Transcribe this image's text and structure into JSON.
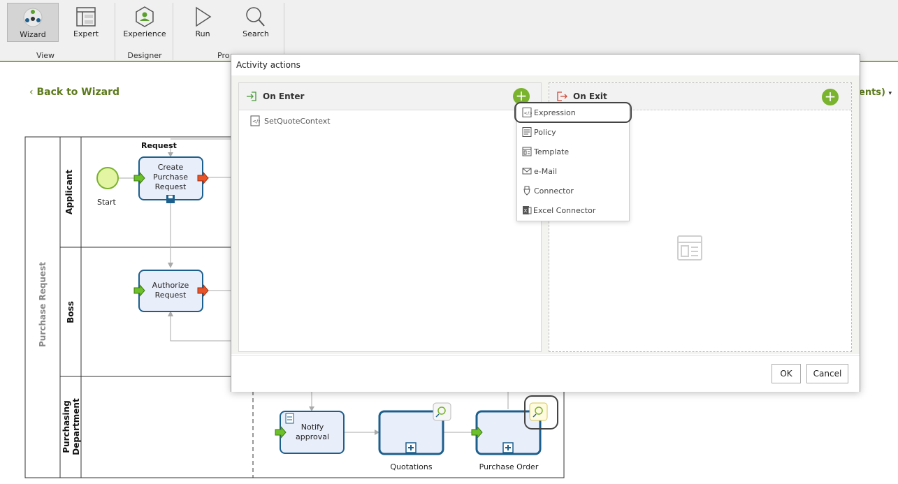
{
  "ribbon": {
    "buttons": [
      {
        "label": "Wizard",
        "icon": "wizard-icon"
      },
      {
        "label": "Expert",
        "icon": "expert-icon"
      },
      {
        "label": "Experience",
        "icon": "experience-icon"
      },
      {
        "label": "Run",
        "icon": "run-icon"
      },
      {
        "label": "Search",
        "icon": "search-icon"
      }
    ],
    "groups": {
      "view": "View",
      "designer": "Designer",
      "process": "Pro"
    }
  },
  "back_link": "Back to Wizard",
  "background_fragment": "ents)",
  "diagram": {
    "pool": "Purchase Request",
    "lanes": [
      "Applicant",
      "Boss",
      "Purchasing Department"
    ],
    "flow_label": "Request",
    "start": "Start",
    "tasks": {
      "create": "Create Purchase Request",
      "authorize": "Authorize Request",
      "notify": "Notify approval",
      "quotations": "Quotations",
      "purchase_order": "Purchase Order"
    }
  },
  "dialog": {
    "title": "Activity actions",
    "on_enter": {
      "label": "On Enter",
      "items": [
        "SetQuoteContext"
      ]
    },
    "on_exit": {
      "label": "On Exit"
    },
    "ok": "OK",
    "cancel": "Cancel"
  },
  "menu": {
    "items": [
      {
        "label": "Expression",
        "icon": "expression-icon"
      },
      {
        "label": "Policy",
        "icon": "policy-icon"
      },
      {
        "label": "Template",
        "icon": "template-icon"
      },
      {
        "label": "e-Mail",
        "icon": "email-icon"
      },
      {
        "label": "Connector",
        "icon": "connector-icon"
      },
      {
        "label": "Excel Connector",
        "icon": "excel-connector-icon"
      }
    ]
  },
  "colors": {
    "accent": "#7ab32e",
    "lane_border": "#333333",
    "task_border": "#1d5f8c",
    "task_fill": "#e9eefb"
  }
}
